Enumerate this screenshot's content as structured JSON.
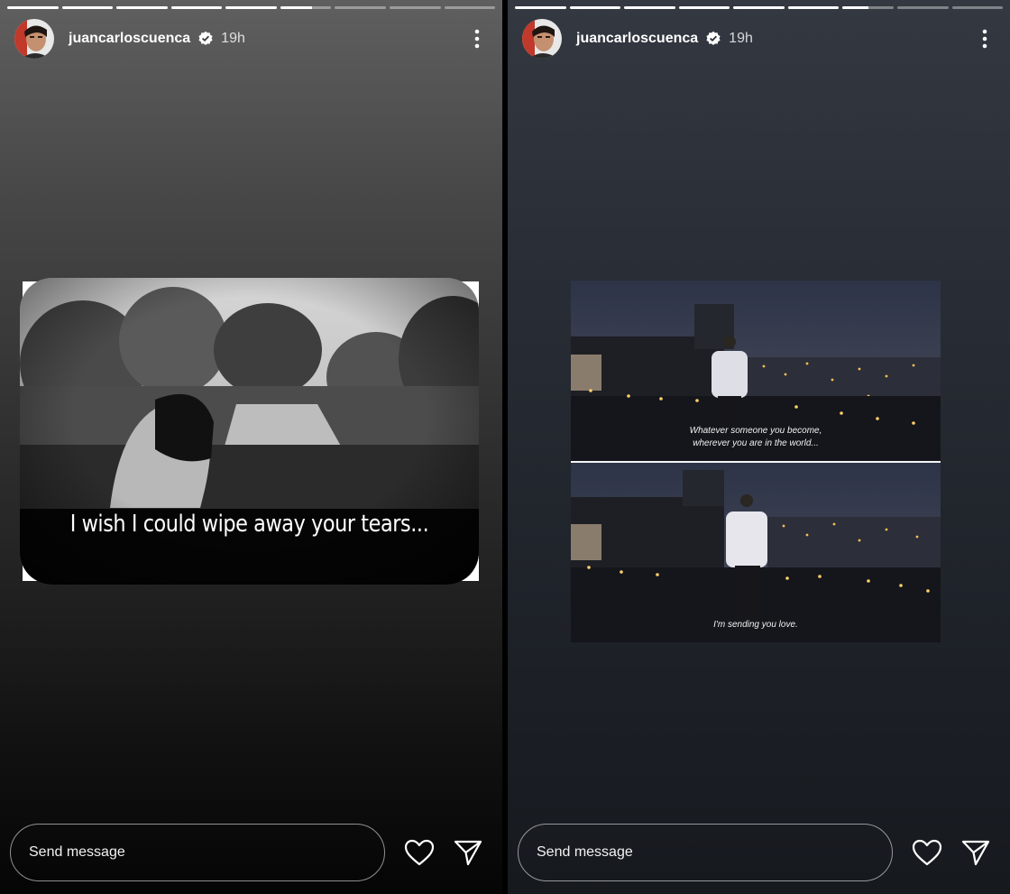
{
  "left_story": {
    "username": "juancarloscuenca",
    "time": "19h",
    "segments": [
      1,
      1,
      1,
      1,
      1,
      0.62,
      0,
      0,
      0
    ],
    "caption": "I wish I could wipe away your tears...",
    "message_placeholder": "Send message"
  },
  "right_story": {
    "username": "juancarloscuenca",
    "time": "19h",
    "segments": [
      1,
      1,
      1,
      1,
      1,
      1,
      0.5,
      0,
      0
    ],
    "subtitle_top_line1": "Whatever someone you become,",
    "subtitle_top_line2": "wherever you are in the world...",
    "subtitle_bottom": "I'm sending you love.",
    "message_placeholder": "Send message"
  },
  "icons": {
    "more": "more-vertical-icon",
    "like": "heart-icon",
    "share": "paper-plane-icon",
    "verified": "verified-badge-icon"
  },
  "colors": {
    "verified_badge": "#ffffff",
    "text": "#ffffff"
  }
}
